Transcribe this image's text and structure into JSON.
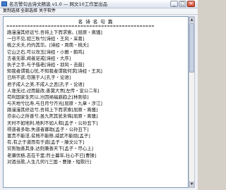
{
  "window": {
    "title": "名言警句古诗文精选 v1.0  —  网文10工作室出品"
  },
  "menu": [
    "复制选择",
    "全部选择",
    "关于软件"
  ],
  "titlebar_buttons": {
    "minimize": "_",
    "maximize": "□",
    "close": "×"
  },
  "document": {
    "heading": "名 诗 名 句 篇",
    "separator": "==================================================",
    "lines": [
      "路漫漫其修远兮,吾将上下而求索。[屈原・离骚]",
      "一日不见,如三秋兮[诗经・王风・采葛]",
      "桃之夭夭,灼灼其华。[诗经・周南・桃夭]",
      "它山之石,可以攻玉[诗经・小雅・鹤鸣]",
      "言者无罪,闻者足戒[诗经・大序]",
      "执子之手,与子偕老[诗经・邶风・击鼓]",
      "知我者谓我心忧,不知我者谓我何求[诗经・王风]",
      "已所不欲,勿施于人[孔子・论语]",
      "君子成人之美,不成人之恶[孔子・论语]",
      "人谁无过,过而能改,善莫大焉[左传・宣公二年]",
      "苟利国家生死以,岂因祸福避趋之[林则徐]",
      "与天地兮比寿,与日月兮齐光[屈原・九章・涉江]",
      "路漫漫其修远兮,吾将上下而求索[屈原・离骚]",
      "亦余心之所善兮,虽九死其犹未悔[屈原・离骚]",
      "天时不如地利,地利不如人和[孟子・公孙丑下]",
      "得道者多助,失道者寡助[孟子・公孙丑下]",
      "富贵不能淫,贫贱不能移,威武不能屈[孟子]",
      "有,有之于道而有于道[孟子・滕文公下]",
      "穷则独善其身,达则兼善天下[孟子・尽心上]",
      "老骥伏枥,志在千里;烈士暮年,壮心不已[曹操]",
      "对酒当歌,人生几何?[三国・曹操・短歌行]"
    ]
  }
}
